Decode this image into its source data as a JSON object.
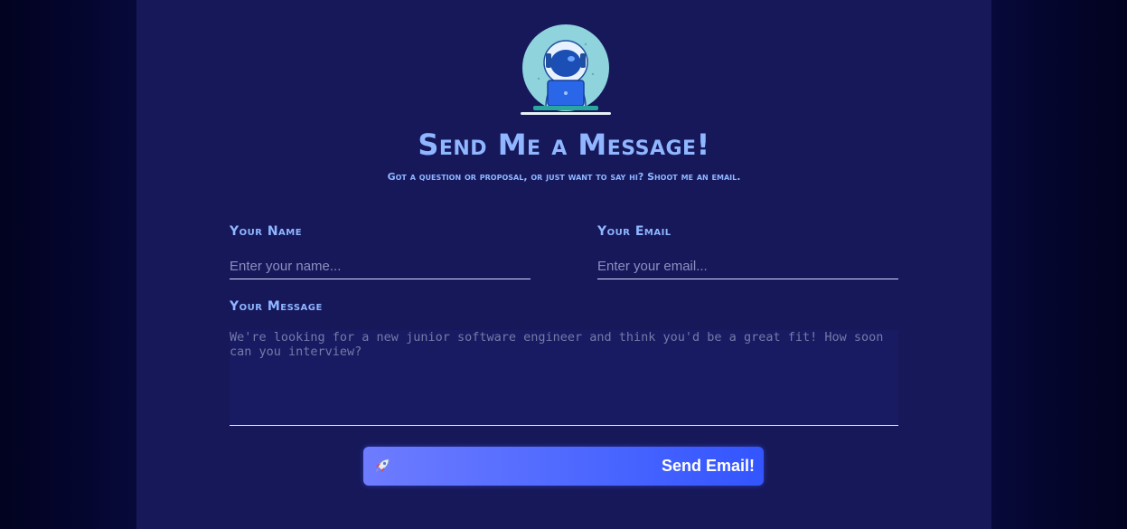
{
  "contact": {
    "title": "Send Me a Message!",
    "subtitle": "Got a question or proposal, or just want to say hi? Shoot me an email.",
    "name_label": "Your Name",
    "name_placeholder": "Enter your name...",
    "email_label": "Your Email",
    "email_placeholder": "Enter your email...",
    "message_label": "Your Message",
    "message_placeholder": "We're looking for a new junior software engineer and think you'd be a great fit! How soon can you interview?",
    "send_label": "Send Email!"
  },
  "icons": {
    "avatar": "astronaut-laptop-icon",
    "send": "rocket-icon"
  },
  "colors": {
    "background": "#03042a",
    "panel": "#16185a",
    "accent_text": "#8fb6ff",
    "button_start": "#6e7cff",
    "button_end": "#3355ff"
  }
}
